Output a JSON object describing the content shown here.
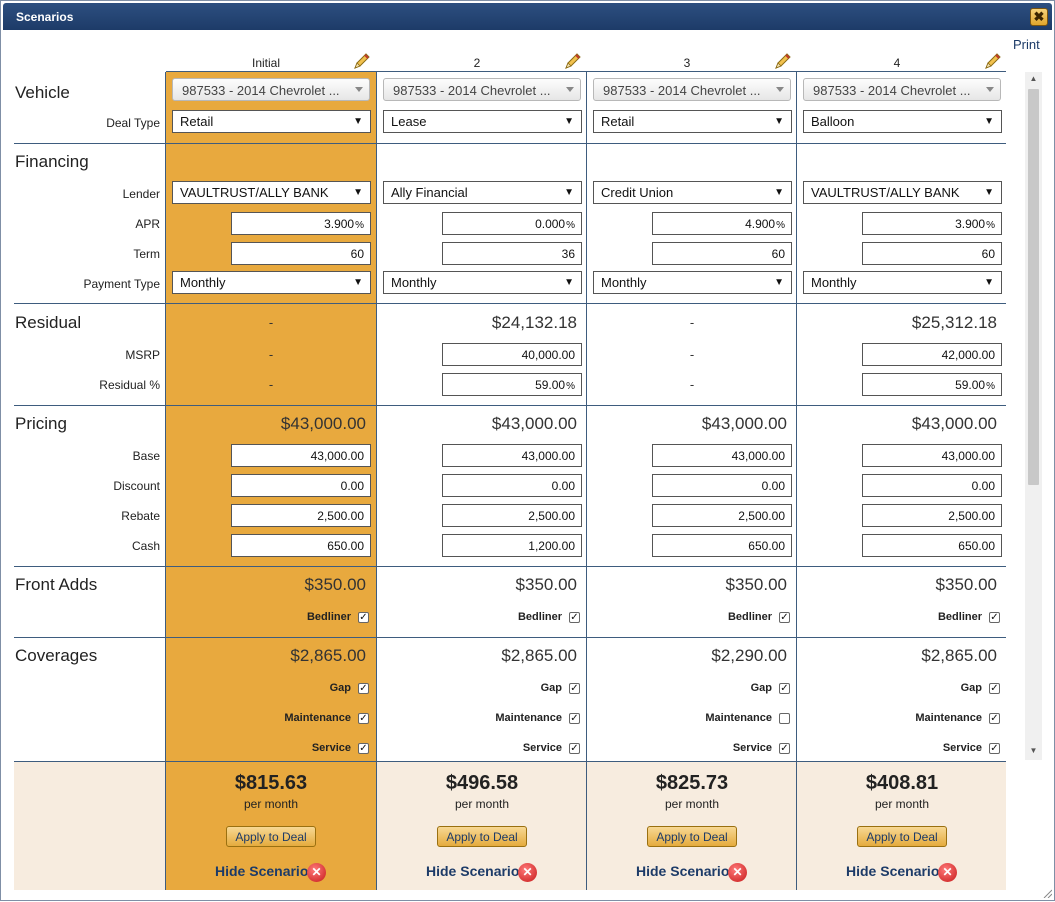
{
  "window": {
    "title": "Scenarios",
    "close_glyph": "✖",
    "print_label": "Print"
  },
  "columns": [
    {
      "header": "Initial",
      "vehicle": "987533 - 2014 Chevrolet ...",
      "deal_type": "Retail",
      "lender": "VAULTRUST/ALLY BANK",
      "apr": "3.900",
      "term": "60",
      "payment_type": "Monthly",
      "residual_total": "-",
      "msrp": "-",
      "residual_pct": "-",
      "pricing_total": "$43,000.00",
      "base": "43,000.00",
      "discount": "0.00",
      "rebate": "2,500.00",
      "cash": "650.00",
      "front_adds_total": "$350.00",
      "bedliner": true,
      "coverages_total": "$2,865.00",
      "gap": true,
      "maintenance": true,
      "service": true,
      "payment": "$815.63"
    },
    {
      "header": "2",
      "vehicle": "987533 - 2014 Chevrolet ...",
      "deal_type": "Lease",
      "lender": "Ally Financial",
      "apr": "0.000",
      "term": "36",
      "payment_type": "Monthly",
      "residual_total": "$24,132.18",
      "msrp": "40,000.00",
      "residual_pct": "59.00",
      "pricing_total": "$43,000.00",
      "base": "43,000.00",
      "discount": "0.00",
      "rebate": "2,500.00",
      "cash": "1,200.00",
      "front_adds_total": "$350.00",
      "bedliner": true,
      "coverages_total": "$2,865.00",
      "gap": true,
      "maintenance": true,
      "service": true,
      "payment": "$496.58"
    },
    {
      "header": "3",
      "vehicle": "987533 - 2014 Chevrolet ...",
      "deal_type": "Retail",
      "lender": "Credit Union",
      "apr": "4.900",
      "term": "60",
      "payment_type": "Monthly",
      "residual_total": "-",
      "msrp": "-",
      "residual_pct": "-",
      "pricing_total": "$43,000.00",
      "base": "43,000.00",
      "discount": "0.00",
      "rebate": "2,500.00",
      "cash": "650.00",
      "front_adds_total": "$350.00",
      "bedliner": true,
      "coverages_total": "$2,290.00",
      "gap": true,
      "maintenance": false,
      "service": true,
      "payment": "$825.73"
    },
    {
      "header": "4",
      "vehicle": "987533 - 2014 Chevrolet ...",
      "deal_type": "Balloon",
      "lender": "VAULTRUST/ALLY BANK",
      "apr": "3.900",
      "term": "60",
      "payment_type": "Monthly",
      "residual_total": "$25,312.18",
      "msrp": "42,000.00",
      "residual_pct": "59.00",
      "pricing_total": "$43,000.00",
      "base": "43,000.00",
      "discount": "0.00",
      "rebate": "2,500.00",
      "cash": "650.00",
      "front_adds_total": "$350.00",
      "bedliner": true,
      "coverages_total": "$2,865.00",
      "gap": true,
      "maintenance": true,
      "service": true,
      "payment": "$408.81"
    }
  ],
  "sections": {
    "vehicle": "Vehicle",
    "financing": "Financing",
    "residual": "Residual",
    "pricing": "Pricing",
    "front_adds": "Front Adds",
    "coverages": "Coverages"
  },
  "labels": {
    "deal_type": "Deal Type",
    "lender": "Lender",
    "apr": "APR",
    "term": "Term",
    "payment_type": "Payment Type",
    "msrp": "MSRP",
    "residual_pct": "Residual %",
    "base": "Base",
    "discount": "Discount",
    "rebate": "Rebate",
    "cash": "Cash",
    "bedliner": "Bedliner",
    "gap": "Gap",
    "maintenance": "Maintenance",
    "service": "Service",
    "percent_unit": "%",
    "per_month": "per month",
    "apply_to_deal": "Apply to Deal",
    "hide_scenario": "Hide Scenario",
    "select_arrow": "▼",
    "check_mark": "✓",
    "remove_glyph": "✕"
  },
  "icons": {
    "edit": "pencil-icon",
    "remove": "red-x-icon"
  },
  "colors": {
    "title_bar": "#1d3b68",
    "initial_column": "#e8a93e",
    "footer": "#f7ecdf",
    "link": "#1d3b68"
  }
}
